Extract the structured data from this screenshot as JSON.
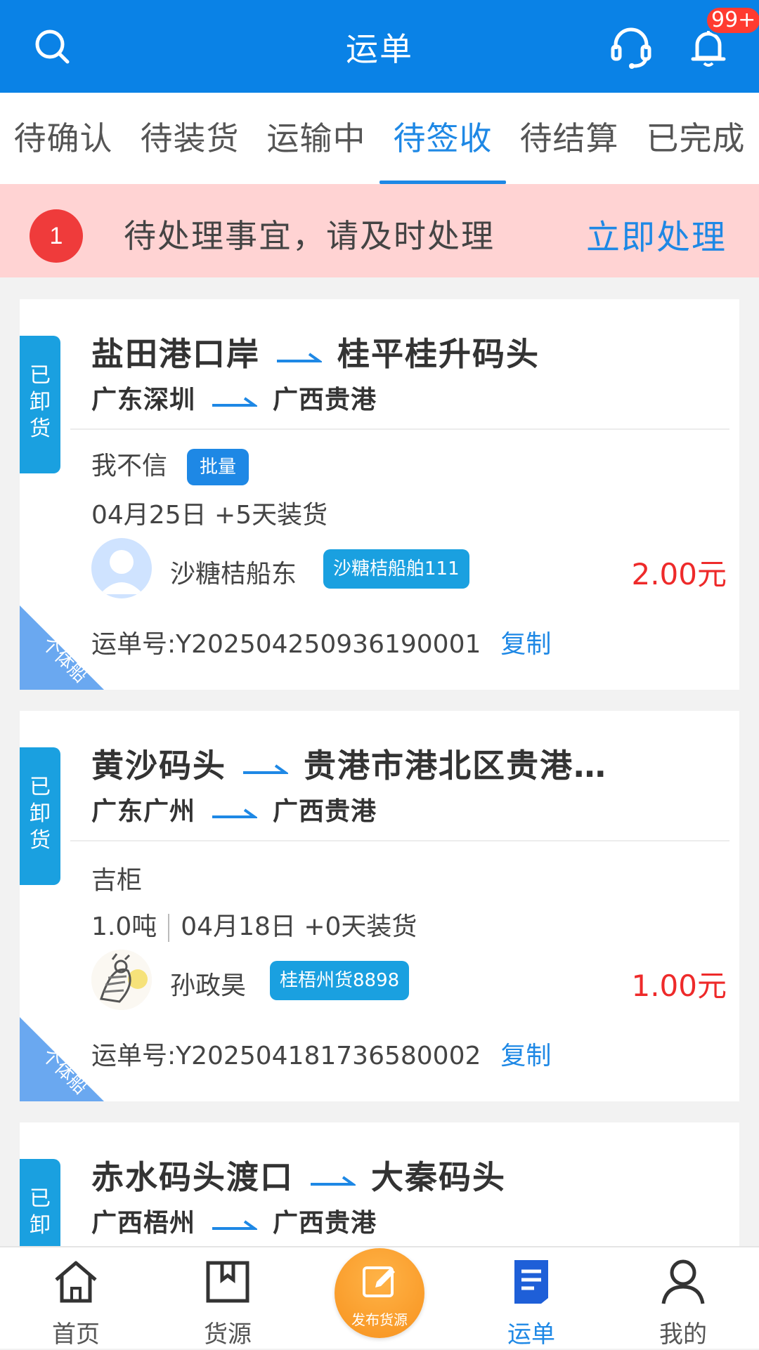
{
  "header": {
    "title": "运单",
    "badge": "99+",
    "colors": {
      "primary": "#0a82e6",
      "badge": "#ff3b30"
    }
  },
  "tabs": [
    {
      "label": "待确认"
    },
    {
      "label": "待装货"
    },
    {
      "label": "运输中"
    },
    {
      "label": "待签收",
      "active": true
    },
    {
      "label": "待结算"
    },
    {
      "label": "已完成"
    }
  ],
  "notice": {
    "count": "1",
    "message": "待处理事宜，请及时处理",
    "action": "立即处理"
  },
  "cards": [
    {
      "status": [
        "已",
        "卸",
        "货"
      ],
      "from_port": "盐田港口岸",
      "to_port": "桂平桂升码头",
      "from_city": "广东深圳",
      "to_city": "广西贵港",
      "cargo": "我不信",
      "cargo_tag": "批量",
      "load_info": "04月25日 +5天装货",
      "owner": "沙糖桔船东",
      "ship": "沙糖桔船舶111",
      "price": "2.00元",
      "waybill": "运单号:Y202504250936190001",
      "copy": "复制",
      "corner": "个体船"
    },
    {
      "status": [
        "已",
        "卸",
        "货"
      ],
      "from_port": "黄沙码头",
      "to_port": "贵港市港北区贵港…",
      "from_city": "广东广州",
      "to_city": "广西贵港",
      "cargo": "吉柜",
      "weight": "1.0吨",
      "load_info": "04月18日 +0天装货",
      "owner": "孙政昊",
      "ship": "桂梧州货8898",
      "price": "1.00元",
      "waybill": "运单号:Y202504181736580002",
      "copy": "复制",
      "corner": "个体船"
    },
    {
      "status": [
        "已",
        "卸"
      ],
      "from_port": "赤水码头渡口",
      "to_port": "大秦码头",
      "from_city": "广西梧州",
      "to_city": "广西贵港"
    }
  ],
  "bottom_nav": [
    {
      "label": "首页",
      "icon": "home-icon"
    },
    {
      "label": "货源",
      "icon": "box-icon"
    },
    {
      "label": "发布货源",
      "icon": "edit-icon"
    },
    {
      "label": "运单",
      "icon": "waybill-icon",
      "active": true
    },
    {
      "label": "我的",
      "icon": "user-icon"
    }
  ]
}
